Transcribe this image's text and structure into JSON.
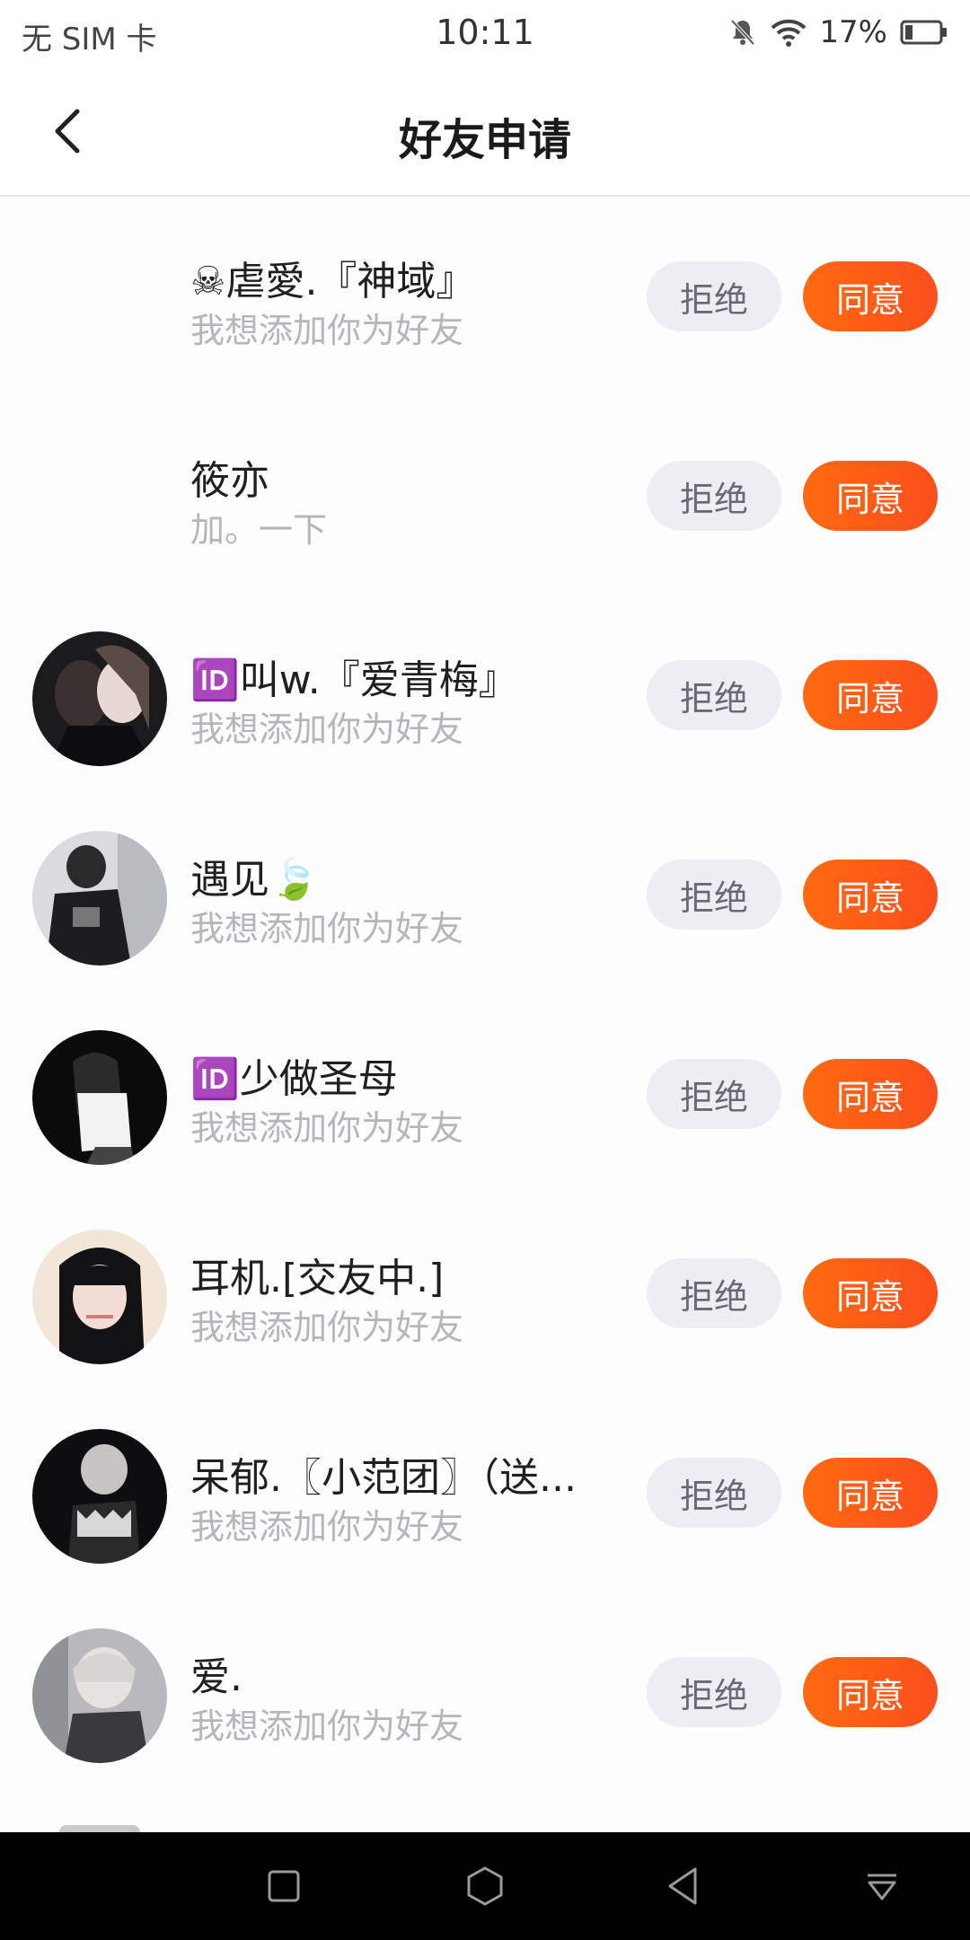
{
  "status_bar": {
    "sim": "无 SIM 卡",
    "time": "10:11",
    "battery": "17%",
    "icons": [
      "bell-muted-icon",
      "wifi-icon",
      "battery-icon"
    ]
  },
  "header": {
    "title": "好友申请",
    "back_icon": "chevron-left-icon"
  },
  "requests": [
    {
      "name": "☠虐愛.『神域』",
      "message": "我想添加你为好友",
      "reject": "拒绝",
      "accept": "同意",
      "has_avatar": false
    },
    {
      "name": "筱亦",
      "message": "加。一下",
      "reject": "拒绝",
      "accept": "同意",
      "has_avatar": false
    },
    {
      "name": "🆔叫w.『爱青梅』",
      "message": "我想添加你为好友",
      "reject": "拒绝",
      "accept": "同意",
      "has_avatar": true
    },
    {
      "name": "遇见🍃",
      "message": "我想添加你为好友",
      "reject": "拒绝",
      "accept": "同意",
      "has_avatar": true
    },
    {
      "name": "🆔少做圣母",
      "message": "我想添加你为好友",
      "reject": "拒绝",
      "accept": "同意",
      "has_avatar": true
    },
    {
      "name": "耳机.[交友中.]",
      "message": "我想添加你为好友",
      "reject": "拒绝",
      "accept": "同意",
      "has_avatar": true
    },
    {
      "name": "呆郁.〖小范团〗（送...",
      "message": "我想添加你为好友",
      "reject": "拒绝",
      "accept": "同意",
      "has_avatar": true
    },
    {
      "name": "爱.",
      "message": "我想添加你为好友",
      "reject": "拒绝",
      "accept": "同意",
      "has_avatar": true
    }
  ],
  "colors": {
    "accept_bg": "#ff5a12",
    "reject_bg": "#eceef4",
    "message_text": "#b5b5bb"
  },
  "nav_bar": {
    "icons": [
      "square-icon",
      "hexagon-home-icon",
      "triangle-back-icon",
      "dropdown-icon"
    ]
  }
}
